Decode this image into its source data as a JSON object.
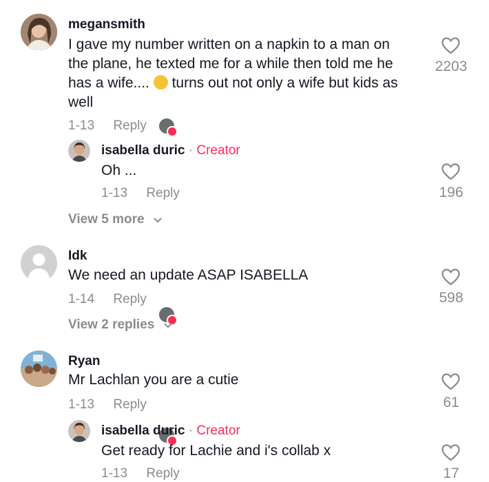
{
  "comments": [
    {
      "username": "megansmith",
      "text_lines": [
        "I gave my number written on a napkin to a man on",
        "the plane, he texted me for a while then told me he",
        "has a wife....",
        "turns out not only a wife but kids as",
        "well"
      ],
      "date": "1-13",
      "reply_label": "Reply",
      "likes": "2203",
      "reply": {
        "username": "isabella duric",
        "separator": "·",
        "creator_label": "Creator",
        "text": "Oh ...",
        "date": "1-13",
        "reply_label": "Reply",
        "likes": "196"
      },
      "view_more": "View 5 more"
    },
    {
      "username": "Idk",
      "text": "We need an update ASAP ISABELLA",
      "date": "1-14",
      "reply_label": "Reply",
      "likes": "598",
      "view_more": "View 2 replies"
    },
    {
      "username": "Ryan",
      "text": "Mr Lachlan you are a cutie",
      "date": "1-13",
      "reply_label": "Reply",
      "likes": "61",
      "reply": {
        "username": "isabella duric",
        "separator": "·",
        "creator_label": "Creator",
        "text": "Get ready for Lachie and i's collab x",
        "date": "1-13",
        "reply_label": "Reply",
        "likes": "17"
      }
    }
  ],
  "icons": {
    "heart": "heart-outline-icon",
    "chevron": "chevron-down-icon",
    "emoji": "upside-down-face-emoji",
    "creator_liked": "creator-liked-badge"
  },
  "colors": {
    "text": "#161823",
    "muted": "#8a8b91",
    "creator": "#fe2c55"
  }
}
